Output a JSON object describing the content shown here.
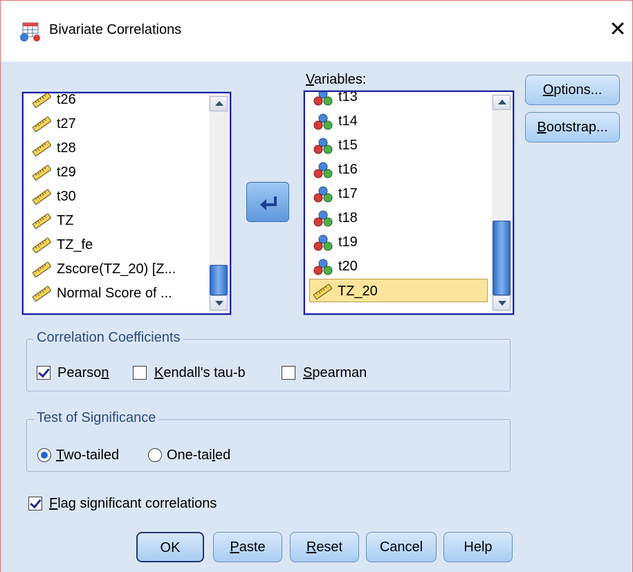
{
  "window": {
    "title": "Bivariate Correlations"
  },
  "source_list": {
    "items": [
      "t26",
      "t27",
      "t28",
      "t29",
      "t30",
      "TZ",
      "TZ_fe",
      "Zscore(TZ_20) [Z...",
      "Normal Score of ..."
    ]
  },
  "variables": {
    "label": "Variables:",
    "label_mnemonic": "V",
    "label_rest": "ariables:",
    "items": [
      "t13",
      "t14",
      "t15",
      "t16",
      "t17",
      "t18",
      "t19",
      "t20",
      "TZ_20"
    ],
    "selected": "TZ_20"
  },
  "side_buttons": {
    "options_pre": "",
    "options_mn": "O",
    "options_post": "ptions...",
    "bootstrap_pre": "",
    "bootstrap_mn": "B",
    "bootstrap_post": "ootstrap..."
  },
  "correlation_coefficients": {
    "title": "Correlation Coefficients",
    "pearson": {
      "pre": "Pearso",
      "mn": "n",
      "post": "",
      "checked": true
    },
    "kendall": {
      "pre": "",
      "mn": "K",
      "post": "endall's tau-b",
      "checked": false
    },
    "spearman": {
      "pre": "",
      "mn": "S",
      "post": "pearman",
      "checked": false
    }
  },
  "test_of_significance": {
    "title": "Test of Significance",
    "two_tailed": {
      "pre": "",
      "mn": "T",
      "post": "wo-tailed",
      "selected": true
    },
    "one_tailed": {
      "pre": "One-tai",
      "mn": "l",
      "post": "ed",
      "selected": false
    }
  },
  "flag": {
    "pre": "",
    "mn": "F",
    "post": "lag significant correlations",
    "checked": true
  },
  "buttons": {
    "ok": "OK",
    "paste_pre": "",
    "paste_mn": "P",
    "paste_post": "aste",
    "reset_pre": "",
    "reset_mn": "R",
    "reset_post": "eset",
    "cancel": "Cancel",
    "help": "Help"
  },
  "colors": {
    "dialog_bg": "#dbe6f4",
    "selection": "#fce49b",
    "list_border": "#1f1fa8",
    "button": "#a9cdf3"
  },
  "icons": {
    "scale": "ruler-icon",
    "nominal": "three-circles-icon"
  }
}
